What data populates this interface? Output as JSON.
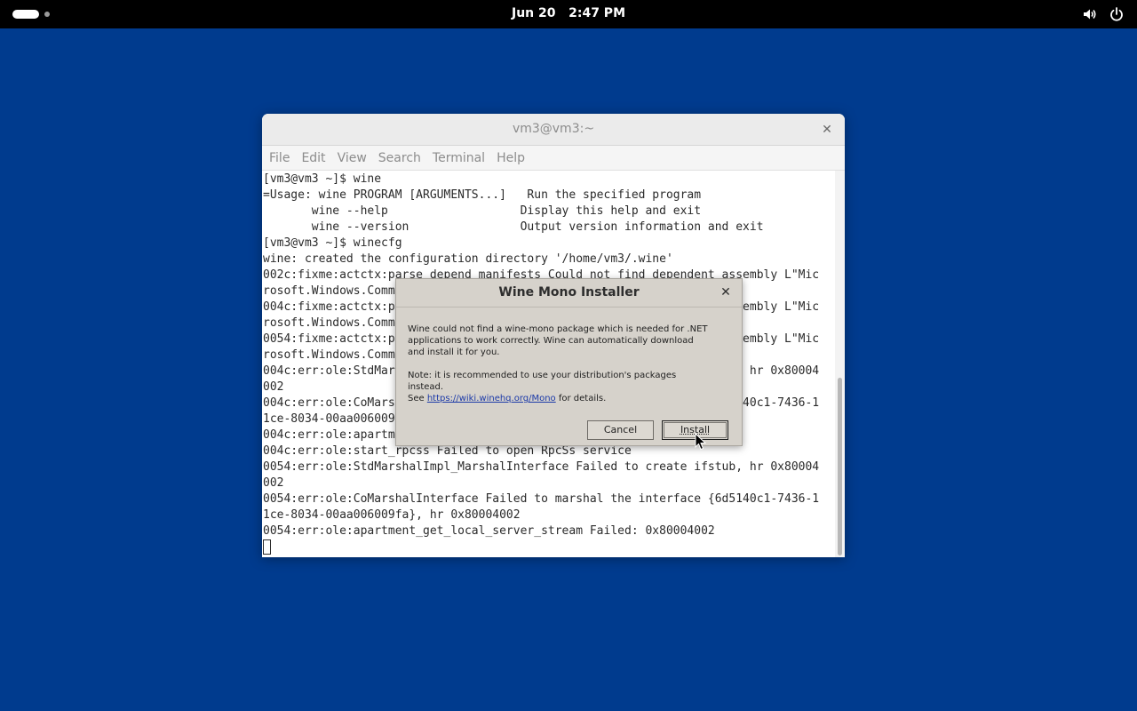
{
  "topbar": {
    "date": "Jun 20",
    "time": "2:47 PM",
    "icons": [
      "activities-indicator",
      "volume-icon",
      "power-icon"
    ]
  },
  "terminal": {
    "title": "vm3@vm3:~",
    "menu": [
      "File",
      "Edit",
      "View",
      "Search",
      "Terminal",
      "Help"
    ],
    "lines": [
      "[vm3@vm3 ~]$ wine",
      "=Usage: wine PROGRAM [ARGUMENTS...]   Run the specified program",
      "       wine --help                   Display this help and exit",
      "       wine --version                Output version information and exit",
      "[vm3@vm3 ~]$ winecfg",
      "wine: created the configuration directory '/home/vm3/.wine'",
      "002c:fixme:actctx:parse_depend_manifests Could not find dependent assembly L\"Mic",
      "rosoft.Windows.Common-Controls\" (6.0.0.0)",
      "004c:fixme:actctx:parse_depend_manifests Could not find dependent assembly L\"Mic",
      "rosoft.Windows.Common-Controls\" (6.0.0.0)",
      "0054:fixme:actctx:parse_depend_manifests Could not find dependent assembly L\"Mic",
      "rosoft.Windows.Common-Controls\" (6.0.0.0)",
      "004c:err:ole:StdMarshalImpl_MarshalInterface Failed to create ifstub, hr 0x80004",
      "002",
      "004c:err:ole:CoMarshalInterface Failed to marshal the interface {6d5140c1-7436-1",
      "1ce-8034-00aa006009fa}, hr 0x80004002",
      "004c:err:ole:apartment_get_local_server_stream Failed: 0x80004002",
      "004c:err:ole:start_rpcss Failed to open RpcSs service",
      "0054:err:ole:StdMarshalImpl_MarshalInterface Failed to create ifstub, hr 0x80004",
      "002",
      "0054:err:ole:CoMarshalInterface Failed to marshal the interface {6d5140c1-7436-1",
      "1ce-8034-00aa006009fa}, hr 0x80004002",
      "0054:err:ole:apartment_get_local_server_stream Failed: 0x80004002"
    ]
  },
  "dialog": {
    "title": "Wine Mono Installer",
    "message_1": "Wine could not find a wine-mono package which is needed for .NET applications to work correctly. Wine can automatically download and install it for you.",
    "note_prefix": "Note: it is recommended to use your distribution's packages instead.",
    "see_label": "See",
    "link_text": "https://wiki.winehq.org/Mono",
    "details_label": "for details.",
    "cancel_label": "Cancel",
    "install_label": "Install"
  },
  "colors": {
    "desktop": "#003b8e",
    "topbar": "#000000",
    "dialog_bg": "#d6d2cb",
    "link": "#1c3aa8"
  }
}
